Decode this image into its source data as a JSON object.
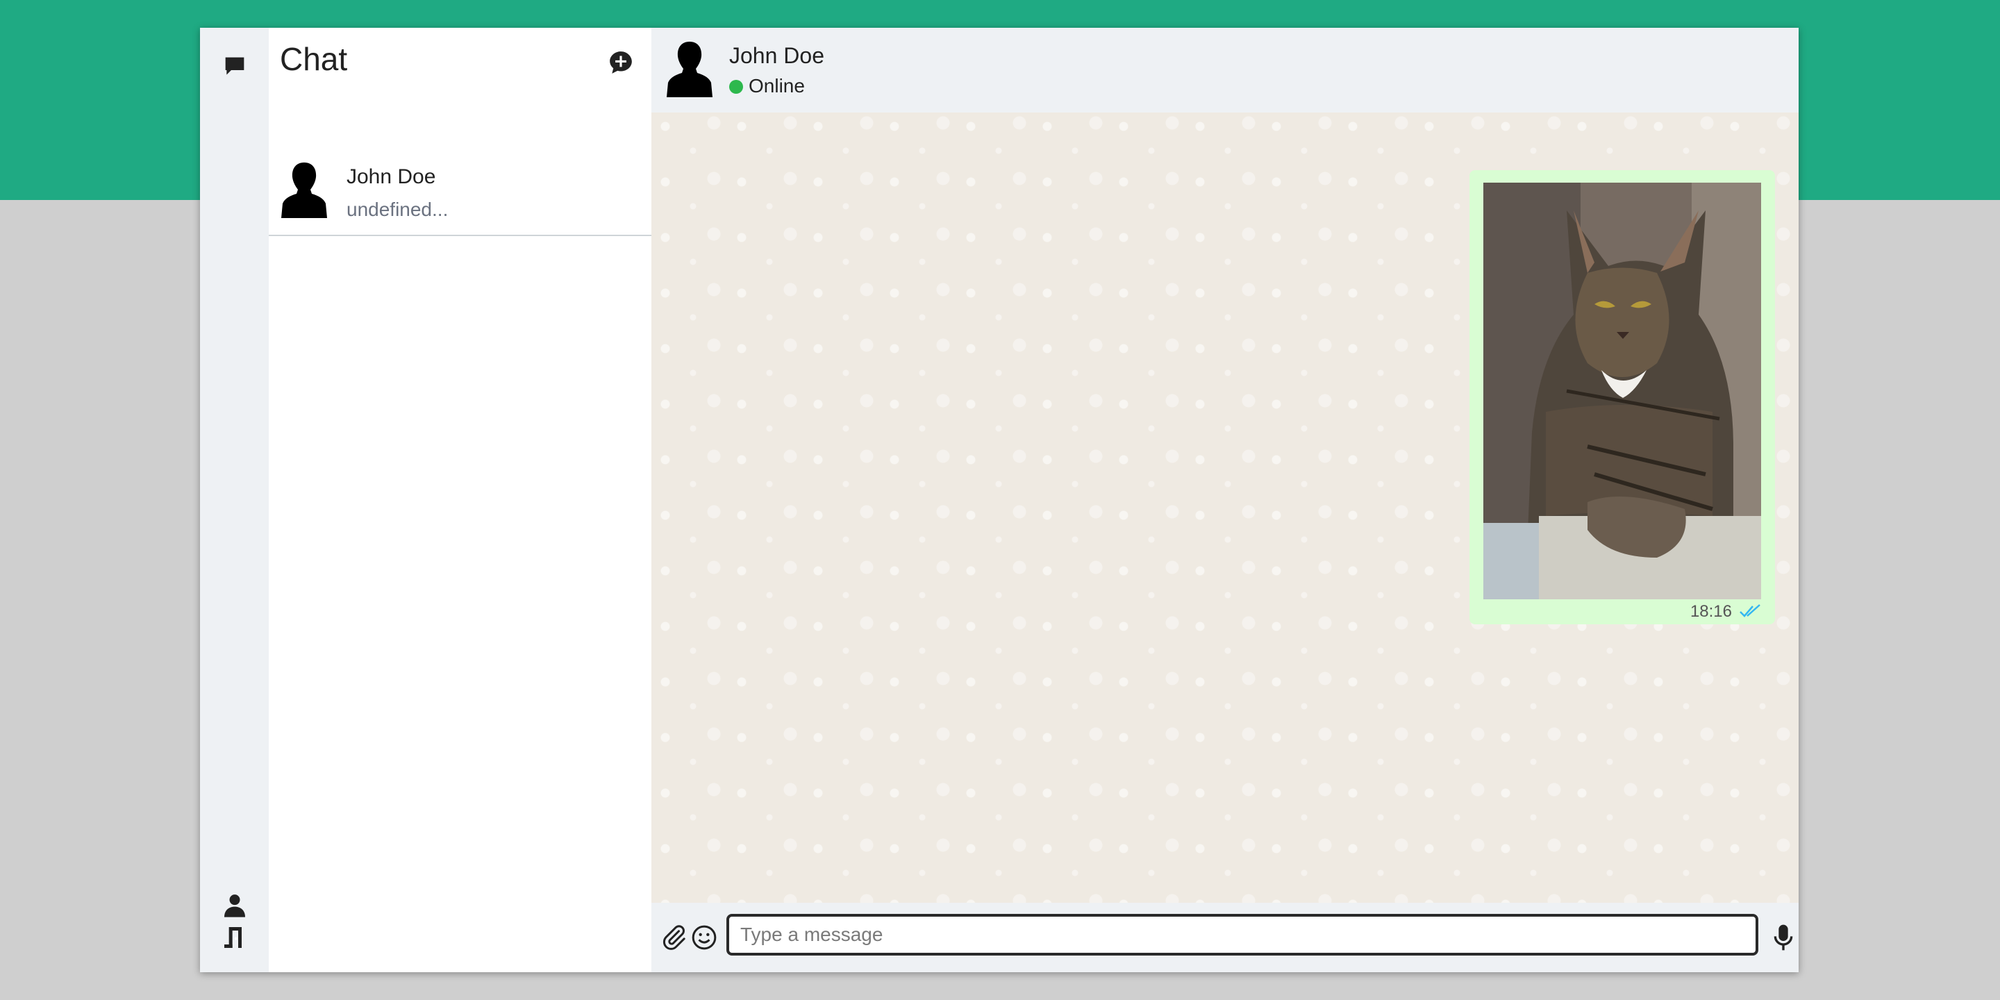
{
  "sidebar": {
    "icons": [
      "chat-bubble-icon",
      "user-icon",
      "logout-icon"
    ]
  },
  "chat_list": {
    "title": "Chat",
    "new_chat_icon": "new-chat-icon",
    "contacts": [
      {
        "name": "John Doe",
        "preview": "undefined..."
      }
    ]
  },
  "conversation": {
    "contact_name": "John Doe",
    "status": "Online",
    "status_color": "#2db84d",
    "messages": [
      {
        "type": "image",
        "subject": "tabby cat",
        "time": "18:16",
        "read_receipt": "double-check-icon"
      }
    ]
  },
  "composer": {
    "placeholder": "Type a message",
    "attach_icon": "paperclip-icon",
    "emoji_icon": "smiley-icon",
    "mic_icon": "microphone-icon"
  },
  "colors": {
    "brand": "#1faa83",
    "sent_bubble": "#d9fdd3",
    "chat_background": "#efeae2",
    "read_tick": "#34b7f1"
  }
}
